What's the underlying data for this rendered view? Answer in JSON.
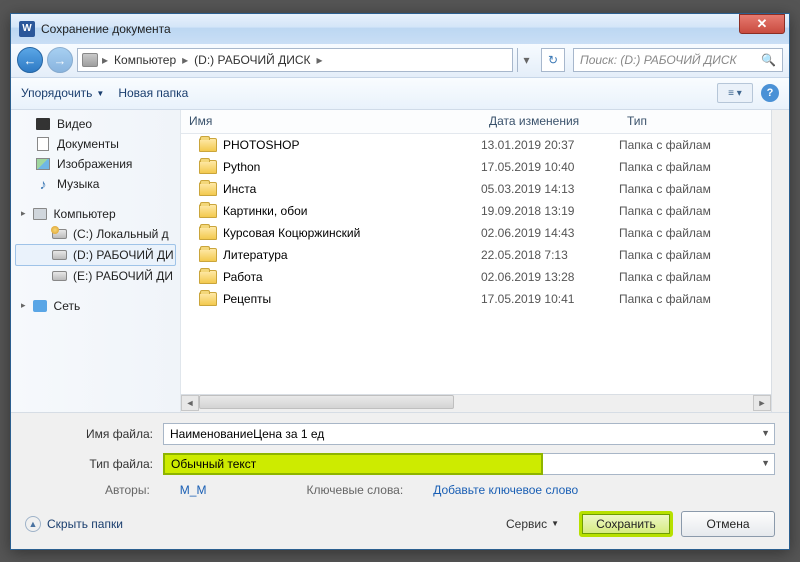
{
  "title": "Сохранение документа",
  "breadcrumb": {
    "root": "Компьютер",
    "drive": "(D:) РАБОЧИЙ ДИСК"
  },
  "search": {
    "placeholder": "Поиск: (D:) РАБОЧИЙ ДИСК"
  },
  "toolbar": {
    "organize": "Упорядочить",
    "newfolder": "Новая папка"
  },
  "sidebar": {
    "video": "Видео",
    "documents": "Документы",
    "images": "Изображения",
    "music": "Музыка",
    "computer": "Компьютер",
    "drive_c": "(C:) Локальный д",
    "drive_d": "(D:) РАБОЧИЙ ДИ",
    "drive_e": "(E:) РАБОЧИЙ ДИ",
    "network": "Сеть"
  },
  "columns": {
    "name": "Имя",
    "date": "Дата изменения",
    "type": "Тип"
  },
  "rows": [
    {
      "name": "PHOTOSHOP",
      "date": "13.01.2019 20:37",
      "type": "Папка с файлам"
    },
    {
      "name": "Python",
      "date": "17.05.2019 10:40",
      "type": "Папка с файлам"
    },
    {
      "name": "Инста",
      "date": "05.03.2019 14:13",
      "type": "Папка с файлам"
    },
    {
      "name": "Картинки, обои",
      "date": "19.09.2018 13:19",
      "type": "Папка с файлам"
    },
    {
      "name": "Курсовая Коцюржинский",
      "date": "02.06.2019 14:43",
      "type": "Папка с файлам"
    },
    {
      "name": "Литература",
      "date": "22.05.2018 7:13",
      "type": "Папка с файлам"
    },
    {
      "name": "Работа",
      "date": "02.06.2019 13:28",
      "type": "Папка с файлам"
    },
    {
      "name": "Рецепты",
      "date": "17.05.2019 10:41",
      "type": "Папка с файлам"
    }
  ],
  "form": {
    "filename_label": "Имя файла:",
    "filename_value": "НаименованиеЦена за 1 ед",
    "filetype_label": "Тип файла:",
    "filetype_value": "Обычный текст",
    "authors_label": "Авторы:",
    "authors_value": "M_M",
    "tags_label": "Ключевые слова:",
    "tags_value": "Добавьте ключевое слово"
  },
  "actions": {
    "hide_folders": "Скрыть папки",
    "service": "Сервис",
    "save": "Сохранить",
    "cancel": "Отмена"
  }
}
